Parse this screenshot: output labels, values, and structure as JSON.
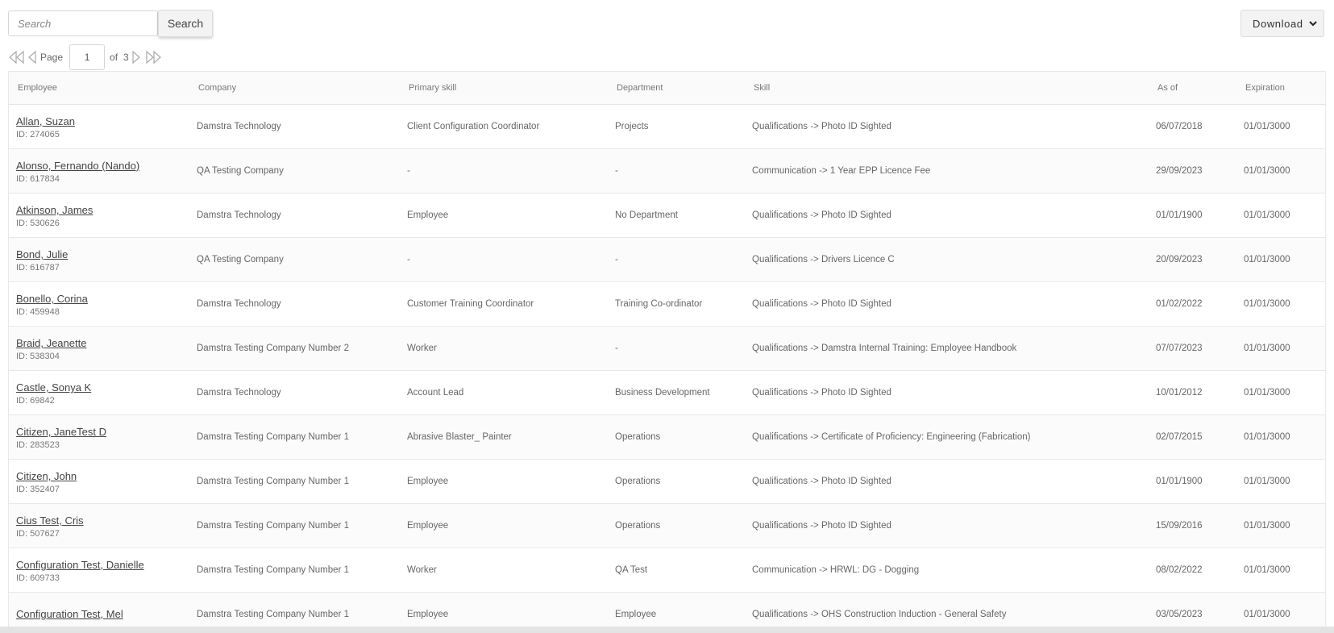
{
  "search": {
    "placeholder": "Search",
    "button_label": "Search"
  },
  "download": {
    "label": "Download"
  },
  "pager": {
    "page_label": "Page",
    "current_page": "1",
    "of_label": "of",
    "total_pages": "3"
  },
  "columns": [
    "Employee",
    "Company",
    "Primary skill",
    "Department",
    "Skill",
    "As of",
    "Expiration"
  ],
  "rows": [
    {
      "name": "Allan, Suzan",
      "id": "ID: 274065",
      "company": "Damstra Technology",
      "primary_skill": "Client Configuration Coordinator",
      "department": "Projects",
      "skill": "Qualifications -> Photo ID Sighted",
      "as_of": "06/07/2018",
      "expiration": "01/01/3000"
    },
    {
      "name": "Alonso, Fernando (Nando)",
      "id": "ID: 617834",
      "company": "QA Testing Company",
      "primary_skill": "-",
      "department": "-",
      "skill": "Communication -> 1 Year EPP Licence Fee",
      "as_of": "29/09/2023",
      "expiration": "01/01/3000"
    },
    {
      "name": "Atkinson, James",
      "id": "ID: 530626",
      "company": "Damstra Technology",
      "primary_skill": "Employee",
      "department": "No Department",
      "skill": "Qualifications -> Photo ID Sighted",
      "as_of": "01/01/1900",
      "expiration": "01/01/3000"
    },
    {
      "name": "Bond, Julie",
      "id": "ID: 616787",
      "company": "QA Testing Company",
      "primary_skill": "-",
      "department": "-",
      "skill": "Qualifications -> Drivers Licence C",
      "as_of": "20/09/2023",
      "expiration": "01/01/3000"
    },
    {
      "name": "Bonello, Corina",
      "id": "ID: 459948",
      "company": "Damstra Technology",
      "primary_skill": "Customer Training Coordinator",
      "department": "Training Co-ordinator",
      "skill": "Qualifications -> Photo ID Sighted",
      "as_of": "01/02/2022",
      "expiration": "01/01/3000"
    },
    {
      "name": "Braid, Jeanette",
      "id": "ID: 538304",
      "company": "Damstra Testing Company Number 2",
      "primary_skill": "Worker",
      "department": "-",
      "skill": "Qualifications -> Damstra Internal Training: Employee Handbook",
      "as_of": "07/07/2023",
      "expiration": "01/01/3000"
    },
    {
      "name": "Castle, Sonya K",
      "id": "ID: 69842",
      "company": "Damstra Technology",
      "primary_skill": "Account Lead",
      "department": "Business Development",
      "skill": "Qualifications -> Photo ID Sighted",
      "as_of": "10/01/2012",
      "expiration": "01/01/3000"
    },
    {
      "name": "Citizen, JaneTest D",
      "id": "ID: 283523",
      "company": "Damstra Testing Company Number 1",
      "primary_skill": "Abrasive Blaster_ Painter",
      "department": "Operations",
      "skill": "Qualifications -> Certificate of Proficiency: Engineering (Fabrication)",
      "as_of": "02/07/2015",
      "expiration": "01/01/3000"
    },
    {
      "name": "Citizen, John",
      "id": "ID: 352407",
      "company": "Damstra Testing Company Number 1",
      "primary_skill": "Employee",
      "department": "Operations",
      "skill": "Qualifications -> Photo ID Sighted",
      "as_of": "01/01/1900",
      "expiration": "01/01/3000"
    },
    {
      "name": "Cius Test, Cris",
      "id": "ID: 507627",
      "company": "Damstra Testing Company Number 1",
      "primary_skill": "Employee",
      "department": "Operations",
      "skill": "Qualifications -> Photo ID Sighted",
      "as_of": "15/09/2016",
      "expiration": "01/01/3000"
    },
    {
      "name": "Configuration Test, Danielle",
      "id": "ID: 609733",
      "company": "Damstra Testing Company Number 1",
      "primary_skill": "Worker",
      "department": "QA Test",
      "skill": "Communication -> HRWL: DG - Dogging",
      "as_of": "08/02/2022",
      "expiration": "01/01/3000"
    },
    {
      "name": "Configuration Test, Mel",
      "id": "",
      "company": "Damstra Testing Company Number 1",
      "primary_skill": "Employee",
      "department": "Employee",
      "skill": "Qualifications -> OHS Construction Induction - General Safety",
      "as_of": "03/05/2023",
      "expiration": "01/01/3000"
    }
  ]
}
